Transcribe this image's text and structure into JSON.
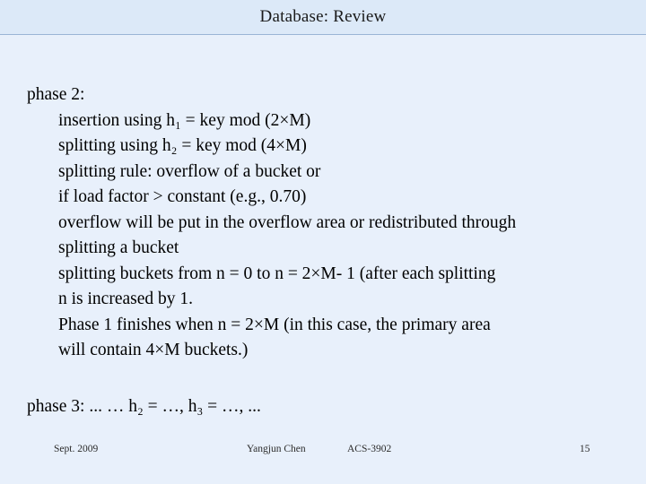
{
  "slide": {
    "title": "Database: Review",
    "body_lines": [
      {
        "text": "phase 2:",
        "indent": false
      },
      {
        "text": "insertion using h₁ = key mod (2×M)",
        "indent": true
      },
      {
        "text": "splitting using h₂ = key mod (4×M)",
        "indent": true
      },
      {
        "text": "splitting rule: overflow of a bucket or",
        "indent": true
      },
      {
        "text": "if load factor > constant (e.g., 0.70)",
        "indent": true
      },
      {
        "text": "overflow will be put in the overflow area or redistributed through",
        "indent": true
      },
      {
        "text": "splitting a bucket",
        "indent": true
      },
      {
        "text": "splitting buckets from n = 0 to n = 2×M- 1 (after each splitting",
        "indent": true
      },
      {
        "text": "n is increased by 1.",
        "indent": true
      },
      {
        "text": "Phase 1 finishes when n = 2×M (in this case, the primary area",
        "indent": true
      },
      {
        "text": "will contain 4×M buckets.)",
        "indent": true
      }
    ],
    "phase3": "phase 3: ... … h₂ = …, h₃ = …, ...",
    "footer": {
      "date": "Sept. 2009",
      "author": "Yangjun Chen",
      "course": "ACS-3902",
      "page": "15"
    }
  }
}
